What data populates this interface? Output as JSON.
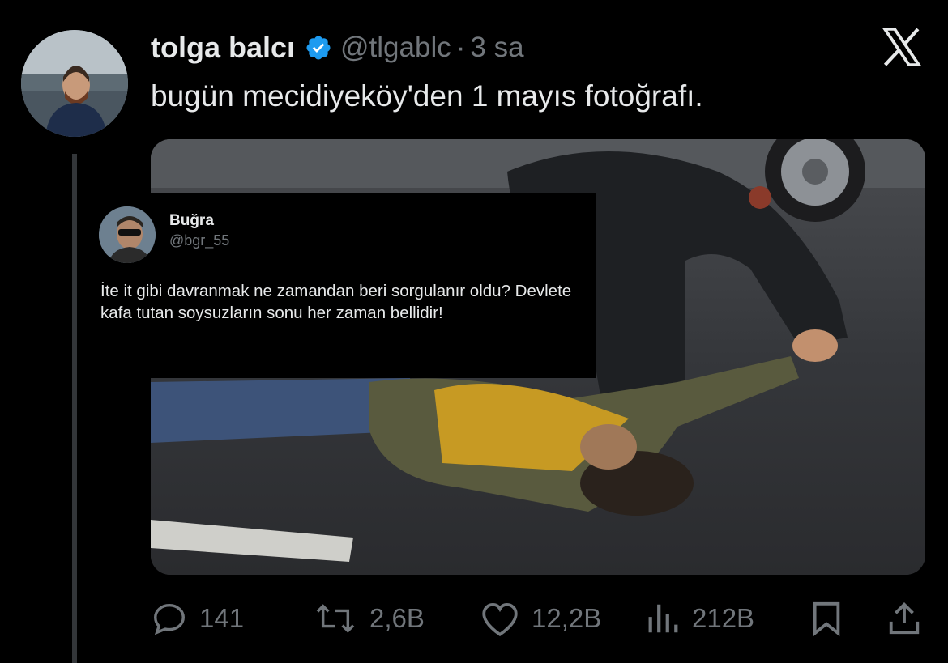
{
  "tweet": {
    "author_name": "tolga balcı",
    "author_handle": "@tlgablc",
    "separator": "·",
    "timestamp": "3 sa",
    "text": "bugün mecidiyeköy'den 1 mayıs fotoğrafı."
  },
  "quoted": {
    "name": "Buğra",
    "handle": "@bgr_55",
    "text": "İte it gibi davranmak ne zamandan beri sorgulanır oldu?  Devlete kafa tutan soysuzların sonu her zaman bellidir!"
  },
  "actions": {
    "replies": "141",
    "reposts": "2,6B",
    "likes": "12,2B",
    "views": "212B"
  },
  "icons": {
    "reply": "reply-icon",
    "repost": "repost-icon",
    "like": "heart-icon",
    "views": "views-icon",
    "bookmark": "bookmark-icon",
    "share": "share-icon",
    "close": "x-logo-icon",
    "verified": "verified-badge-icon"
  },
  "colors": {
    "background": "#000000",
    "text": "#e7e9ea",
    "secondary": "#71767b",
    "verified": "#1d9bf0"
  }
}
